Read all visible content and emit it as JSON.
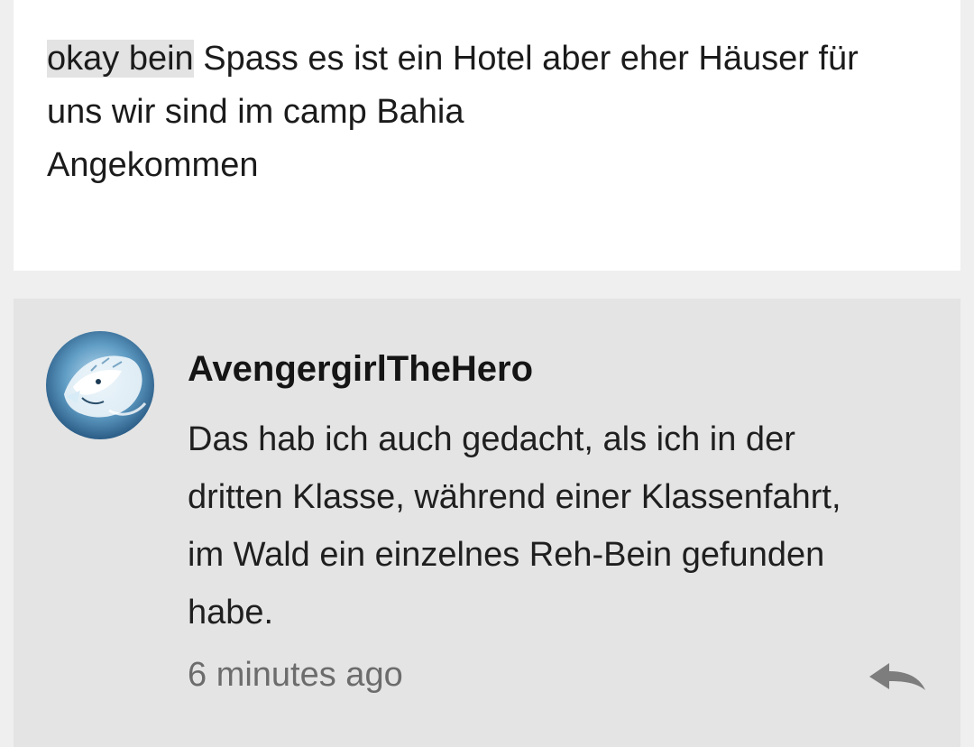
{
  "post": {
    "highlighted": "okay bein",
    "line1_rest": " Spass es ist ein Hotel aber eher Häuser für",
    "line2": "uns wir sind im camp Bahia",
    "line3": "Angekommen"
  },
  "comment": {
    "avatar_icon": "white-tiger-avatar-icon",
    "username": "AvengergirlTheHero",
    "text_lines": [
      "Das hab ich auch gedacht, als ich in der",
      "dritten Klasse, während einer Klassenfahrt,",
      "im Wald ein einzelnes Reh-Bein gefunden",
      "habe."
    ],
    "timestamp": "6 minutes ago",
    "reply_icon": "reply-arrow-icon"
  },
  "colors": {
    "page_background": "#efefef",
    "post_background": "#ffffff",
    "comment_background": "#e4e4e4",
    "highlight": "#e3e3e3",
    "timestamp": "#6c6c6c"
  }
}
